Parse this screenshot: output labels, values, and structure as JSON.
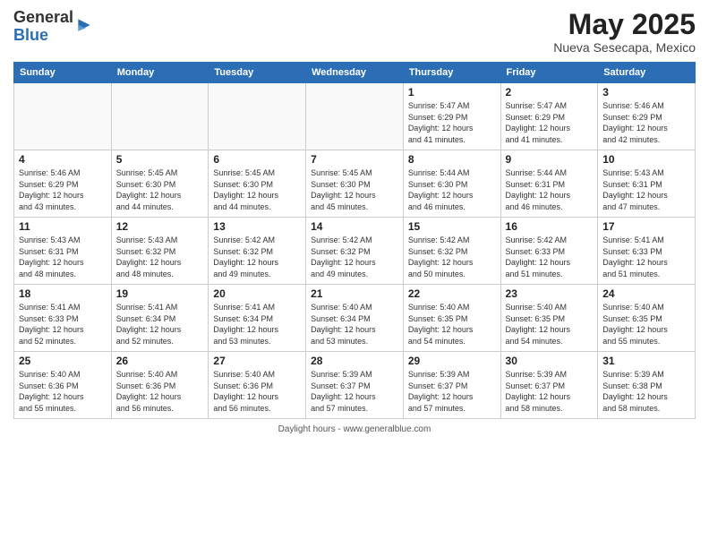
{
  "logo": {
    "general": "General",
    "blue": "Blue"
  },
  "title": "May 2025",
  "location": "Nueva Sesecapa, Mexico",
  "days_header": [
    "Sunday",
    "Monday",
    "Tuesday",
    "Wednesday",
    "Thursday",
    "Friday",
    "Saturday"
  ],
  "footer": "Daylight hours",
  "weeks": [
    [
      {
        "day": "",
        "info": ""
      },
      {
        "day": "",
        "info": ""
      },
      {
        "day": "",
        "info": ""
      },
      {
        "day": "",
        "info": ""
      },
      {
        "day": "1",
        "info": "Sunrise: 5:47 AM\nSunset: 6:29 PM\nDaylight: 12 hours\nand 41 minutes."
      },
      {
        "day": "2",
        "info": "Sunrise: 5:47 AM\nSunset: 6:29 PM\nDaylight: 12 hours\nand 41 minutes."
      },
      {
        "day": "3",
        "info": "Sunrise: 5:46 AM\nSunset: 6:29 PM\nDaylight: 12 hours\nand 42 minutes."
      }
    ],
    [
      {
        "day": "4",
        "info": "Sunrise: 5:46 AM\nSunset: 6:29 PM\nDaylight: 12 hours\nand 43 minutes."
      },
      {
        "day": "5",
        "info": "Sunrise: 5:45 AM\nSunset: 6:30 PM\nDaylight: 12 hours\nand 44 minutes."
      },
      {
        "day": "6",
        "info": "Sunrise: 5:45 AM\nSunset: 6:30 PM\nDaylight: 12 hours\nand 44 minutes."
      },
      {
        "day": "7",
        "info": "Sunrise: 5:45 AM\nSunset: 6:30 PM\nDaylight: 12 hours\nand 45 minutes."
      },
      {
        "day": "8",
        "info": "Sunrise: 5:44 AM\nSunset: 6:30 PM\nDaylight: 12 hours\nand 46 minutes."
      },
      {
        "day": "9",
        "info": "Sunrise: 5:44 AM\nSunset: 6:31 PM\nDaylight: 12 hours\nand 46 minutes."
      },
      {
        "day": "10",
        "info": "Sunrise: 5:43 AM\nSunset: 6:31 PM\nDaylight: 12 hours\nand 47 minutes."
      }
    ],
    [
      {
        "day": "11",
        "info": "Sunrise: 5:43 AM\nSunset: 6:31 PM\nDaylight: 12 hours\nand 48 minutes."
      },
      {
        "day": "12",
        "info": "Sunrise: 5:43 AM\nSunset: 6:32 PM\nDaylight: 12 hours\nand 48 minutes."
      },
      {
        "day": "13",
        "info": "Sunrise: 5:42 AM\nSunset: 6:32 PM\nDaylight: 12 hours\nand 49 minutes."
      },
      {
        "day": "14",
        "info": "Sunrise: 5:42 AM\nSunset: 6:32 PM\nDaylight: 12 hours\nand 49 minutes."
      },
      {
        "day": "15",
        "info": "Sunrise: 5:42 AM\nSunset: 6:32 PM\nDaylight: 12 hours\nand 50 minutes."
      },
      {
        "day": "16",
        "info": "Sunrise: 5:42 AM\nSunset: 6:33 PM\nDaylight: 12 hours\nand 51 minutes."
      },
      {
        "day": "17",
        "info": "Sunrise: 5:41 AM\nSunset: 6:33 PM\nDaylight: 12 hours\nand 51 minutes."
      }
    ],
    [
      {
        "day": "18",
        "info": "Sunrise: 5:41 AM\nSunset: 6:33 PM\nDaylight: 12 hours\nand 52 minutes."
      },
      {
        "day": "19",
        "info": "Sunrise: 5:41 AM\nSunset: 6:34 PM\nDaylight: 12 hours\nand 52 minutes."
      },
      {
        "day": "20",
        "info": "Sunrise: 5:41 AM\nSunset: 6:34 PM\nDaylight: 12 hours\nand 53 minutes."
      },
      {
        "day": "21",
        "info": "Sunrise: 5:40 AM\nSunset: 6:34 PM\nDaylight: 12 hours\nand 53 minutes."
      },
      {
        "day": "22",
        "info": "Sunrise: 5:40 AM\nSunset: 6:35 PM\nDaylight: 12 hours\nand 54 minutes."
      },
      {
        "day": "23",
        "info": "Sunrise: 5:40 AM\nSunset: 6:35 PM\nDaylight: 12 hours\nand 54 minutes."
      },
      {
        "day": "24",
        "info": "Sunrise: 5:40 AM\nSunset: 6:35 PM\nDaylight: 12 hours\nand 55 minutes."
      }
    ],
    [
      {
        "day": "25",
        "info": "Sunrise: 5:40 AM\nSunset: 6:36 PM\nDaylight: 12 hours\nand 55 minutes."
      },
      {
        "day": "26",
        "info": "Sunrise: 5:40 AM\nSunset: 6:36 PM\nDaylight: 12 hours\nand 56 minutes."
      },
      {
        "day": "27",
        "info": "Sunrise: 5:40 AM\nSunset: 6:36 PM\nDaylight: 12 hours\nand 56 minutes."
      },
      {
        "day": "28",
        "info": "Sunrise: 5:39 AM\nSunset: 6:37 PM\nDaylight: 12 hours\nand 57 minutes."
      },
      {
        "day": "29",
        "info": "Sunrise: 5:39 AM\nSunset: 6:37 PM\nDaylight: 12 hours\nand 57 minutes."
      },
      {
        "day": "30",
        "info": "Sunrise: 5:39 AM\nSunset: 6:37 PM\nDaylight: 12 hours\nand 58 minutes."
      },
      {
        "day": "31",
        "info": "Sunrise: 5:39 AM\nSunset: 6:38 PM\nDaylight: 12 hours\nand 58 minutes."
      }
    ]
  ]
}
